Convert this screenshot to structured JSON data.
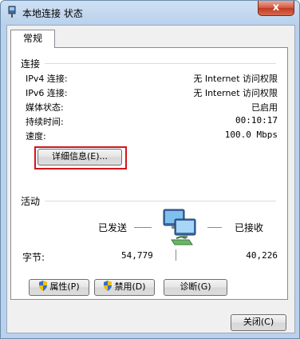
{
  "window": {
    "title": "本地连接 状态",
    "close_label": "x"
  },
  "tabs": [
    {
      "label": "常规"
    }
  ],
  "connection": {
    "heading": "连接",
    "rows": [
      {
        "label": "IPv4 连接:",
        "value": "无 Internet 访问权限"
      },
      {
        "label": "IPv6 连接:",
        "value": "无 Internet 访问权限"
      },
      {
        "label": "媒体状态:",
        "value": "已启用"
      },
      {
        "label": "持续时间:",
        "value": "00:10:17"
      },
      {
        "label": "速度:",
        "value": "100.0 Mbps"
      }
    ],
    "details_button": "详细信息(E)..."
  },
  "activity": {
    "heading": "活动",
    "sent_label": "已发送",
    "received_label": "已接收",
    "bytes_label": "字节:",
    "bytes_sent": "54,779",
    "bytes_received": "40,226"
  },
  "actions": {
    "properties": "属性(P)",
    "disable": "禁用(D)",
    "diagnose": "诊断(G)"
  },
  "footer": {
    "close": "关闭(C)"
  },
  "colors": {
    "highlight": "#d4141c",
    "title_gradient": "#b9d1ec",
    "close_red": "#c23a22"
  }
}
